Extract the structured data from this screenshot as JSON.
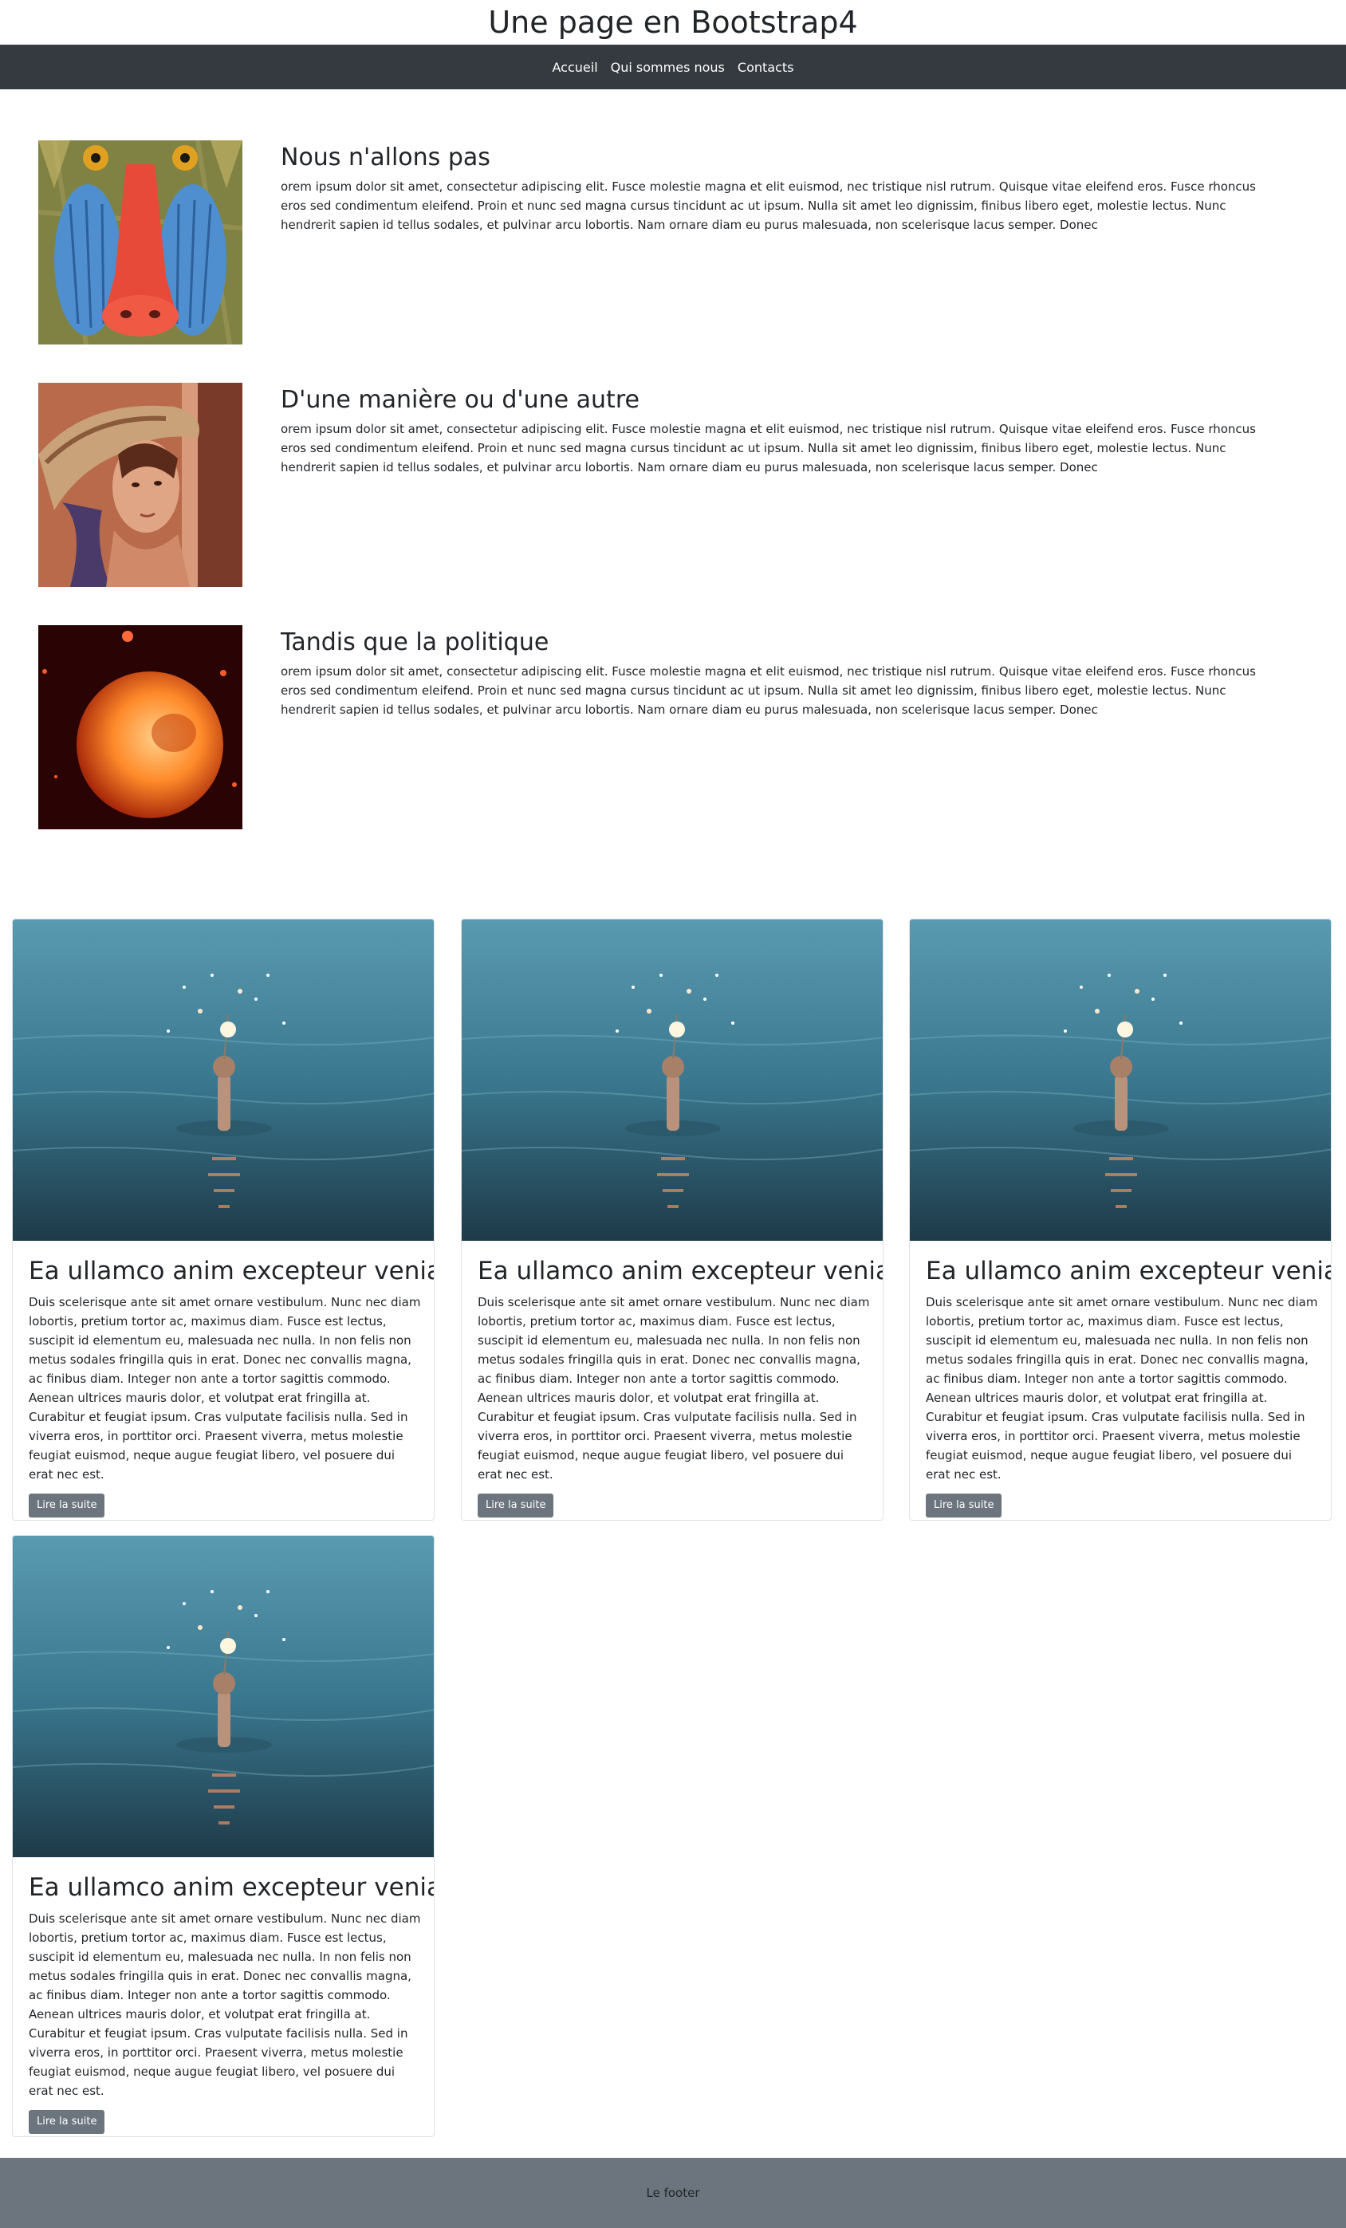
{
  "header": {
    "title": "Une page en Bootstrap4"
  },
  "nav": {
    "items": [
      {
        "label": "Accueil"
      },
      {
        "label": "Qui sommes nous"
      },
      {
        "label": "Contacts"
      }
    ]
  },
  "media": [
    {
      "heading": "Nous n'allons pas",
      "text": "orem ipsum dolor sit amet, consectetur adipiscing elit. Fusce molestie magna et elit euismod, nec tristique nisl rutrum. Quisque vitae eleifend eros. Fusce rhoncus eros sed condimentum eleifend. Proin et nunc sed magna cursus tincidunt ac ut ipsum. Nulla sit amet leo dignissim, finibus libero eget, molestie lectus. Nunc hendrerit sapien id tellus sodales, et pulvinar arcu lobortis. Nam ornare diam eu purus malesuada, non scelerisque lacus semper. Donec"
    },
    {
      "heading": "D'une manière ou d'une autre",
      "text": "orem ipsum dolor sit amet, consectetur adipiscing elit. Fusce molestie magna et elit euismod, nec tristique nisl rutrum. Quisque vitae eleifend eros. Fusce rhoncus eros sed condimentum eleifend. Proin et nunc sed magna cursus tincidunt ac ut ipsum. Nulla sit amet leo dignissim, finibus libero eget, molestie lectus. Nunc hendrerit sapien id tellus sodales, et pulvinar arcu lobortis. Nam ornare diam eu purus malesuada, non scelerisque lacus semper. Donec"
    },
    {
      "heading": "Tandis que la politique",
      "text": "orem ipsum dolor sit amet, consectetur adipiscing elit. Fusce molestie magna et elit euismod, nec tristique nisl rutrum. Quisque vitae eleifend eros. Fusce rhoncus eros sed condimentum eleifend. Proin et nunc sed magna cursus tincidunt ac ut ipsum. Nulla sit amet leo dignissim, finibus libero eget, molestie lectus. Nunc hendrerit sapien id tellus sodales, et pulvinar arcu lobortis. Nam ornare diam eu purus malesuada, non scelerisque lacus semper. Donec"
    }
  ],
  "cards": [
    {
      "title": "Ea ullamco anim excepteur veniam",
      "text": "Duis scelerisque ante sit amet ornare vestibulum. Nunc nec diam lobortis, pretium tortor ac, maximus diam. Fusce est lectus, suscipit id elementum eu, malesuada nec nulla. In non felis non metus sodales fringilla quis in erat. Donec nec convallis magna, ac finibus diam. Integer non ante a tortor sagittis commodo. Aenean ultrices mauris dolor, et volutpat erat fringilla at. Curabitur et feugiat ipsum. Cras vulputate facilisis nulla. Sed in viverra eros, in porttitor orci. Praesent viverra, metus molestie feugiat euismod, neque augue feugiat libero, vel posuere dui erat nec est.",
      "button": "Lire la suite"
    },
    {
      "title": "Ea ullamco anim excepteur veniam",
      "text": "Duis scelerisque ante sit amet ornare vestibulum. Nunc nec diam lobortis, pretium tortor ac, maximus diam. Fusce est lectus, suscipit id elementum eu, malesuada nec nulla. In non felis non metus sodales fringilla quis in erat. Donec nec convallis magna, ac finibus diam. Integer non ante a tortor sagittis commodo. Aenean ultrices mauris dolor, et volutpat erat fringilla at. Curabitur et feugiat ipsum. Cras vulputate facilisis nulla. Sed in viverra eros, in porttitor orci. Praesent viverra, metus molestie feugiat euismod, neque augue feugiat libero, vel posuere dui erat nec est.",
      "button": "Lire la suite"
    },
    {
      "title": "Ea ullamco anim excepteur veniam",
      "text": "Duis scelerisque ante sit amet ornare vestibulum. Nunc nec diam lobortis, pretium tortor ac, maximus diam. Fusce est lectus, suscipit id elementum eu, malesuada nec nulla. In non felis non metus sodales fringilla quis in erat. Donec nec convallis magna, ac finibus diam. Integer non ante a tortor sagittis commodo. Aenean ultrices mauris dolor, et volutpat erat fringilla at. Curabitur et feugiat ipsum. Cras vulputate facilisis nulla. Sed in viverra eros, in porttitor orci. Praesent viverra, metus molestie feugiat euismod, neque augue feugiat libero, vel posuere dui erat nec est.",
      "button": "Lire la suite"
    },
    {
      "title": "Ea ullamco anim excepteur veniam",
      "text": "Duis scelerisque ante sit amet ornare vestibulum. Nunc nec diam lobortis, pretium tortor ac, maximus diam. Fusce est lectus, suscipit id elementum eu, malesuada nec nulla. In non felis non metus sodales fringilla quis in erat. Donec nec convallis magna, ac finibus diam. Integer non ante a tortor sagittis commodo. Aenean ultrices mauris dolor, et volutpat erat fringilla at. Curabitur et feugiat ipsum. Cras vulputate facilisis nulla. Sed in viverra eros, in porttitor orci. Praesent viverra, metus molestie feugiat euismod, neque augue feugiat libero, vel posuere dui erat nec est.",
      "button": "Lire la suite"
    }
  ],
  "footer": {
    "text": "Le footer"
  },
  "colors": {
    "navbar": "#343a40",
    "button": "#6c757d",
    "footer": "#6c757d"
  }
}
